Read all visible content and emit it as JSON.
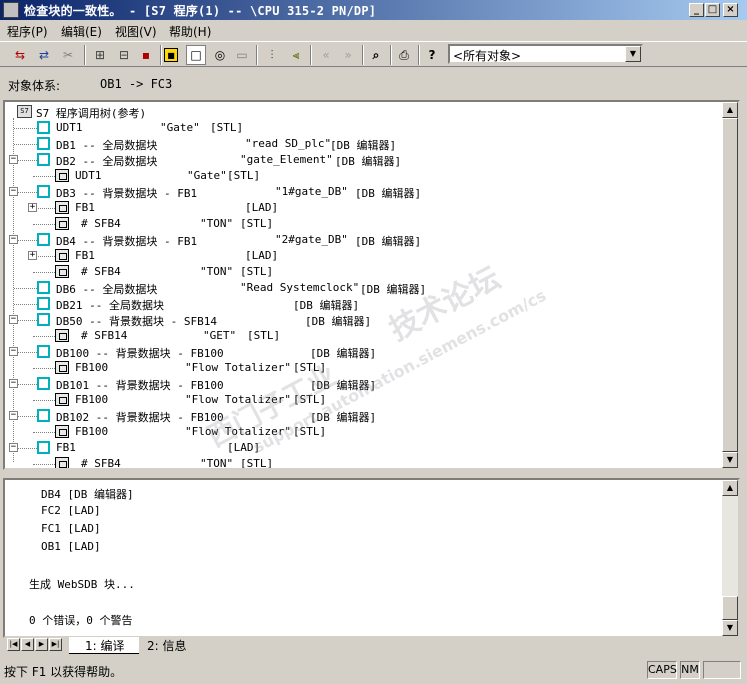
{
  "window": {
    "title": "检查块的一致性。 - [S7 程序(1) -- \\CPU 315-2 PN/DP]",
    "min": "_",
    "max": "□",
    "close": "×"
  },
  "menu": [
    "程序(P)",
    "编辑(E)",
    "视图(V)",
    "帮助(H)"
  ],
  "toolbar": {
    "filter_value": "<所有对象>"
  },
  "object_path": {
    "label": "对象体系:",
    "value": "OB1 -> FC3"
  },
  "tree": {
    "root": "S7 程序调用树(参考)",
    "rows": [
      {
        "name": "UDT1",
        "extra": "\"Gate\"",
        "tag": "[STL]"
      },
      {
        "name": "DB1 -- 全局数据块",
        "extra": "\"read SD_plc\"",
        "tag": "[DB 编辑器]"
      },
      {
        "name": "DB2 -- 全局数据块",
        "extra": "\"gate_Element\"",
        "tag": "[DB 编辑器]"
      },
      {
        "name": "UDT1",
        "extra": "\"Gate\"",
        "tag": "[STL]"
      },
      {
        "name": "DB3 -- 背景数据块 - FB1",
        "extra": "\"1#gate_DB\"",
        "tag": "[DB 编辑器]"
      },
      {
        "name": "FB1",
        "extra": "",
        "tag": "[LAD]"
      },
      {
        "name": "# SFB4",
        "extra": "\"TON\"",
        "tag": "[STL]"
      },
      {
        "name": "DB4 -- 背景数据块 - FB1",
        "extra": "\"2#gate_DB\"",
        "tag": "[DB 编辑器]"
      },
      {
        "name": "FB1",
        "extra": "",
        "tag": "[LAD]"
      },
      {
        "name": "# SFB4",
        "extra": "\"TON\"",
        "tag": "[STL]"
      },
      {
        "name": "DB6 -- 全局数据块",
        "extra": "\"Read Systemclock\"",
        "tag": "[DB 编辑器]"
      },
      {
        "name": "DB21 -- 全局数据块",
        "extra": "",
        "tag": "[DB 编辑器]"
      },
      {
        "name": "DB50 -- 背景数据块 - SFB14",
        "extra": "",
        "tag": "[DB 编辑器]"
      },
      {
        "name": "# SFB14",
        "extra": "\"GET\"",
        "tag": "[STL]"
      },
      {
        "name": "DB100 -- 背景数据块 - FB100",
        "extra": "",
        "tag": "[DB 编辑器]"
      },
      {
        "name": "FB100",
        "extra": "\"Flow Totalizer\"",
        "tag": "[STL]"
      },
      {
        "name": "DB101 -- 背景数据块 - FB100",
        "extra": "",
        "tag": "[DB 编辑器]"
      },
      {
        "name": "FB100",
        "extra": "\"Flow Totalizer\"",
        "tag": "[STL]"
      },
      {
        "name": "DB102 -- 背景数据块 - FB100",
        "extra": "",
        "tag": "[DB 编辑器]"
      },
      {
        "name": "FB100",
        "extra": "\"Flow Totalizer\"",
        "tag": "[STL]"
      },
      {
        "name": "FB1",
        "extra": "",
        "tag": "[LAD]"
      },
      {
        "name": "# SFB4",
        "extra": "\"TON\"",
        "tag": "[STL]"
      }
    ]
  },
  "output": {
    "lines": [
      "DB4  [DB 编辑器]",
      "FC2  [LAD]",
      "FC1  [LAD]",
      "OB1  [LAD]",
      "",
      "生成 WebSDB 块...",
      "",
      "0 个错误，0 个警告"
    ]
  },
  "tabs": [
    "1: 编译",
    "2: 信息"
  ],
  "status": {
    "message": "按下 F1 以获得帮助。",
    "caps": "CAPS",
    "num": "NM"
  },
  "watermark": {
    "line1": "西门子工业",
    "line2": "技术论坛",
    "url": "support.automation.siemens.com/cs"
  }
}
